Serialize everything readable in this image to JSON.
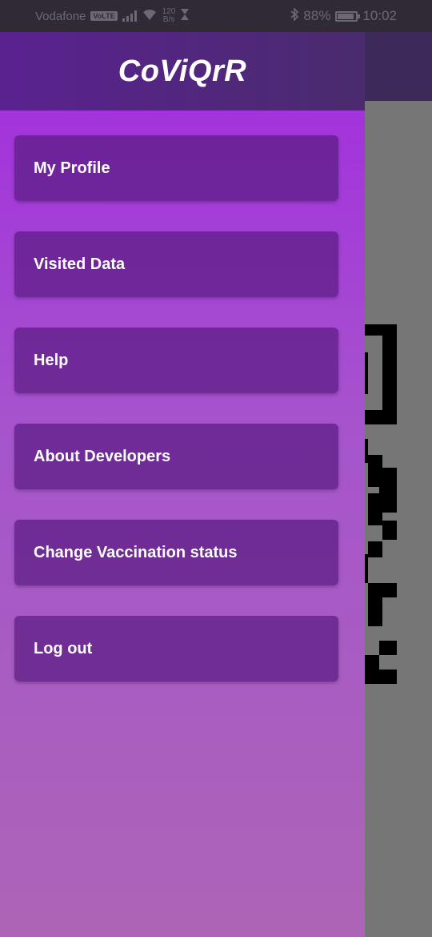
{
  "status_bar": {
    "carrier": "Vodafone",
    "volte": "VoLTE",
    "speed_value": "120",
    "speed_unit": "B/s",
    "battery": "88%",
    "time": "10:02"
  },
  "drawer": {
    "title": "CoViQrR",
    "items": [
      {
        "label": "My Profile"
      },
      {
        "label": "Visited Data"
      },
      {
        "label": "Help"
      },
      {
        "label": "About Developers"
      },
      {
        "label": "Change Vaccination status"
      },
      {
        "label": "Log out"
      }
    ]
  },
  "colors": {
    "drawer_gradient_top": "#a22be0",
    "drawer_gradient_bottom": "#ad64b6",
    "header": "#5a2290",
    "menu_item": "#5a1c82"
  }
}
